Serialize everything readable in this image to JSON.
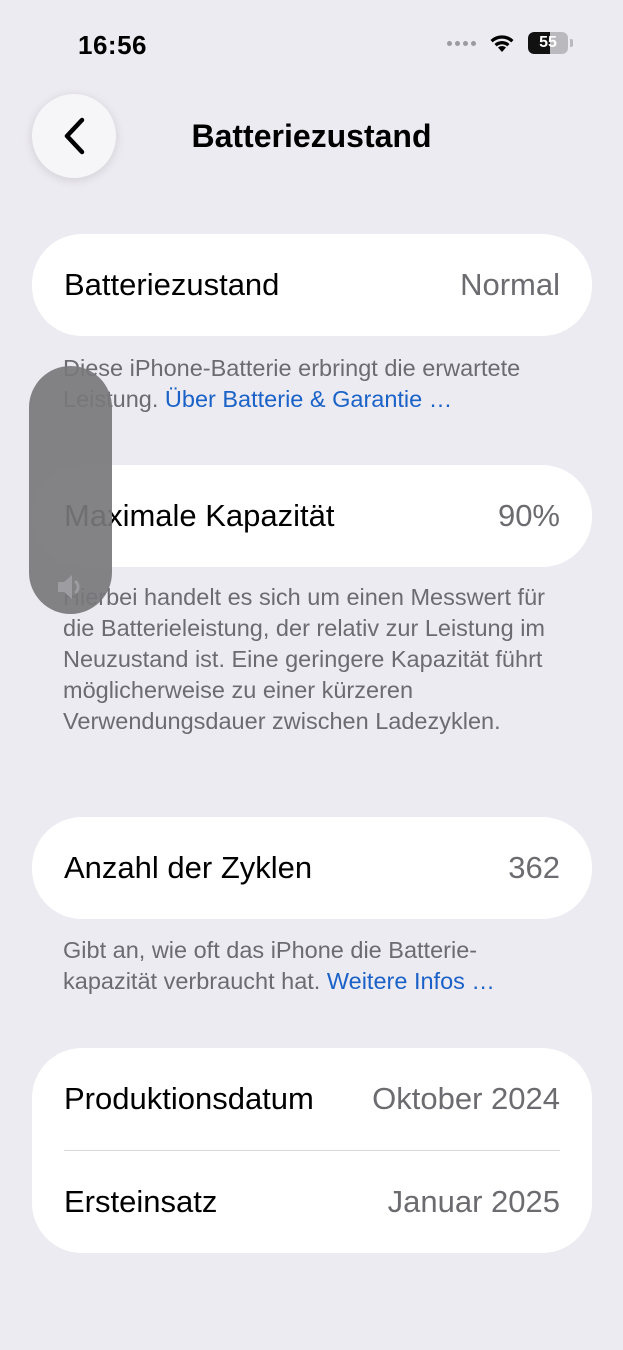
{
  "status_bar": {
    "time": "16:56",
    "battery_level": "55"
  },
  "nav": {
    "title": "Batteriezustand",
    "back_icon": "chevron-left-icon"
  },
  "sections": {
    "health": {
      "label": "Batteriezustand",
      "value": "Normal",
      "footnote_text": "Diese iPhone-Batterie erbringt die erwar­tete Leistung. ",
      "footnote_link": "Über Batterie & Garantie …"
    },
    "capacity": {
      "label": "Maximale Kapazität",
      "value": "90%",
      "footnote_text": "Hierbei handelt es sich um einen Mess­wert für die Batterieleistung, der relativ zur Leistung im Neuzustand ist. Eine geringere Kapazität führt möglicherweise zu einer kürzeren Verwendungsdauer zwischen Ladezyklen."
    },
    "cycles": {
      "label": "Anzahl der Zyklen",
      "value": "362",
      "footnote_text": "Gibt an, wie oft das iPhone die Batterie­kapazität verbraucht hat. ",
      "footnote_link": "Weitere Infos …"
    },
    "dates": {
      "production_label": "Produktionsdatum",
      "production_value": "Oktober 2024",
      "first_use_label": "Ersteinsatz",
      "first_use_value": "Januar 2025"
    }
  },
  "volume_hud": {
    "icon": "speaker-icon"
  },
  "colors": {
    "background": "#ecebf1",
    "link": "#1a62c8",
    "secondary_text": "#6b6b70"
  }
}
